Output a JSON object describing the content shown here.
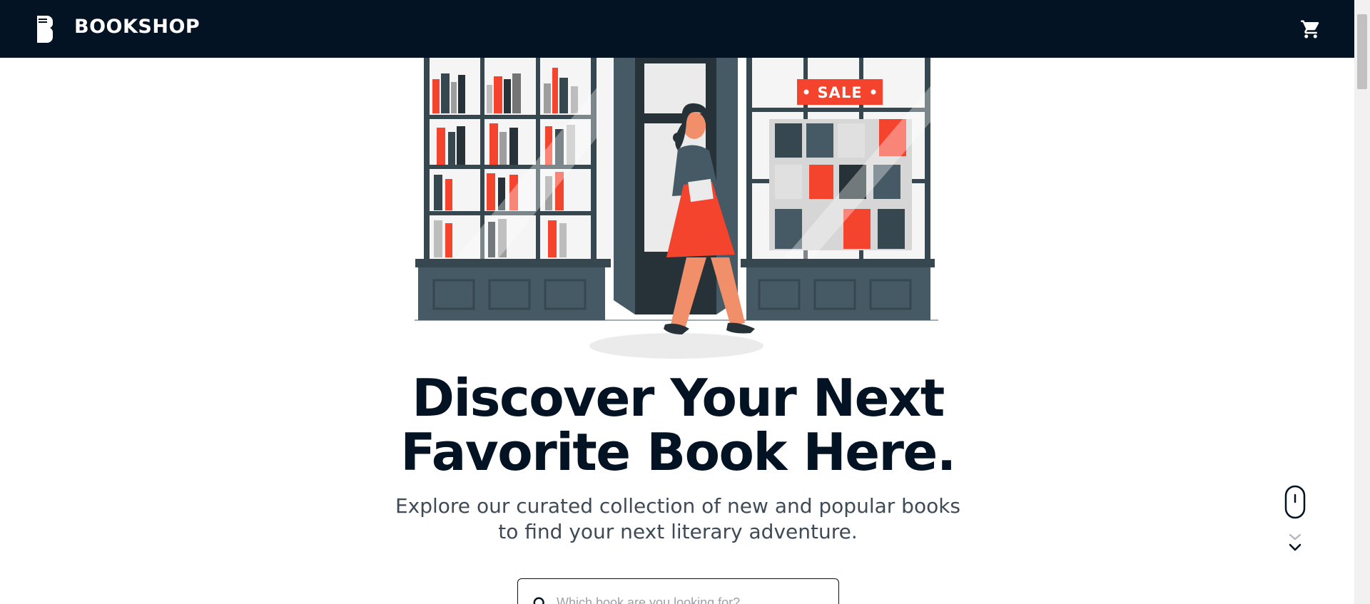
{
  "navbar": {
    "brand": "BOOKSHOP",
    "logo_icon": "book-logo-icon",
    "cart_icon": "shopping-cart-icon",
    "background_color": "#031323"
  },
  "hero": {
    "illustration": {
      "sign_text": "SALE",
      "description_icon": "bookshop-storefront-illustration"
    },
    "headline": "Discover Your Next Favorite Book Here.",
    "subtitle": "Explore our curated collection of new and popular books to find your next literary adventure.",
    "search": {
      "icon": "search-icon",
      "placeholder": "Which book are you looking for?"
    },
    "scroll_indicator": {
      "mouse_icon": "scroll-mouse-icon",
      "arrows_icon": "chevron-down-icon"
    }
  },
  "colors": {
    "navy": "#031323",
    "accent_red": "#f4442e",
    "slate": "#455a64"
  }
}
